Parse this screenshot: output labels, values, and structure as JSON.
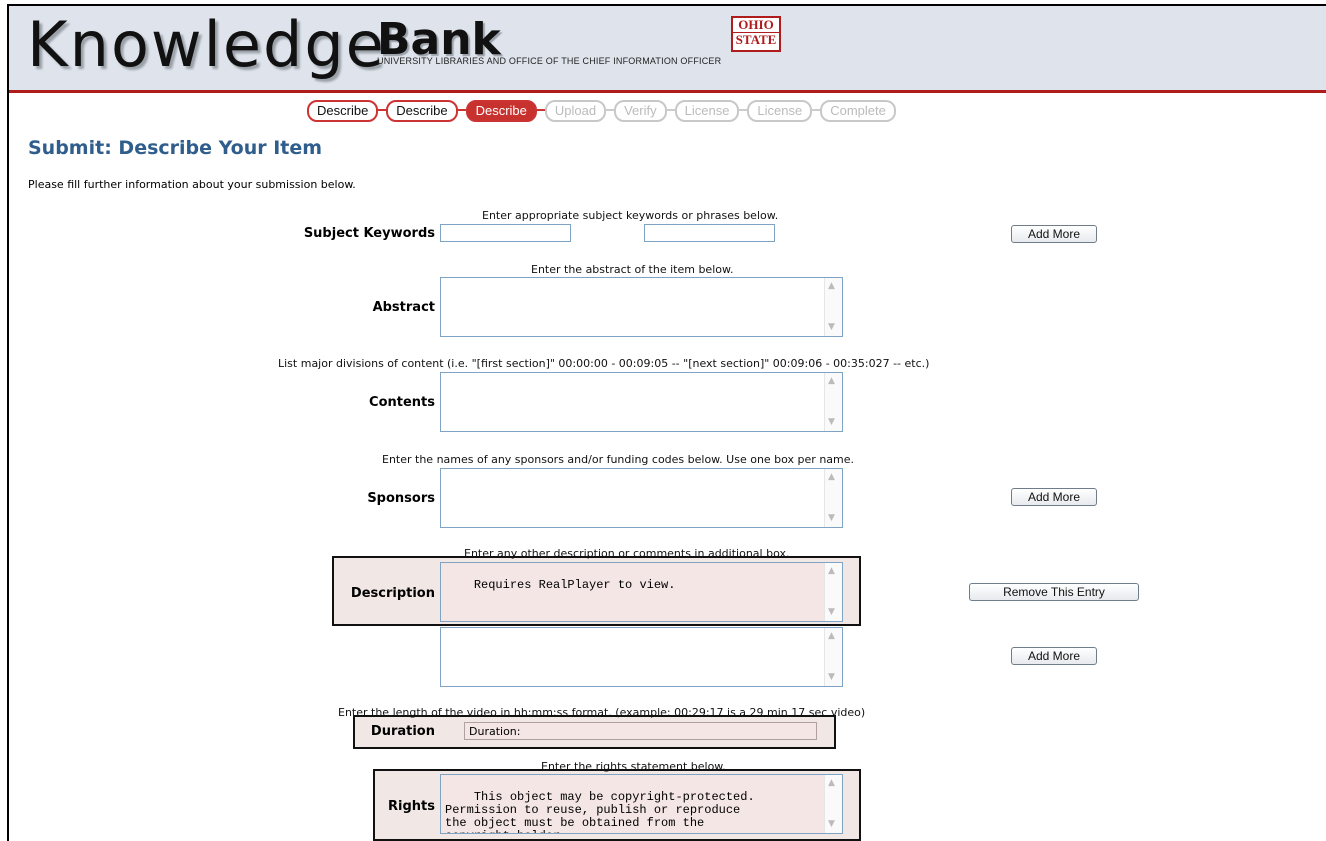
{
  "header": {
    "logo_word": "Knowledge",
    "logo_bank": "Bank",
    "subtitle": "UNIVERSITY LIBRARIES AND OFFICE OF THE CHIEF INFORMATION OFFICER",
    "seal_line1": "OHIO",
    "seal_line2": "STATE"
  },
  "progress": {
    "steps": [
      {
        "label": "Describe",
        "state": "done"
      },
      {
        "label": "Describe",
        "state": "done"
      },
      {
        "label": "Describe",
        "state": "active"
      },
      {
        "label": "Upload",
        "state": "future"
      },
      {
        "label": "Verify",
        "state": "future"
      },
      {
        "label": "License",
        "state": "future"
      },
      {
        "label": "License",
        "state": "future"
      },
      {
        "label": "Complete",
        "state": "future"
      }
    ]
  },
  "page": {
    "title": "Submit: Describe Your Item",
    "intro": "Please fill further information about your submission below."
  },
  "fields": {
    "subject": {
      "hint": "Enter appropriate subject keywords or phrases below.",
      "label": "Subject Keywords",
      "value1": "",
      "value2": "",
      "button": "Add More"
    },
    "abstract": {
      "hint": "Enter the abstract of the item below.",
      "label": "Abstract",
      "value": ""
    },
    "contents": {
      "hint": "List major divisions of content (i.e. \"[first section]\" 00:00:00 - 00:09:05 -- \"[next section]\" 00:09:06 - 00:35:027 -- etc.)",
      "label": "Contents",
      "value": ""
    },
    "sponsors": {
      "hint": "Enter the names of any sponsors and/or funding codes below. Use one box per name.",
      "label": "Sponsors",
      "value": "",
      "button": "Add More"
    },
    "description": {
      "hint": "Enter any other description or comments in additional box.",
      "label": "Description",
      "value": "Requires RealPlayer to view.",
      "remove_button": "Remove This Entry",
      "value2": "",
      "add_button": "Add More"
    },
    "duration": {
      "hint": "Enter the length of the video in hh:mm:ss format. (example: 00:29:17 is a 29 min 17 sec video)",
      "label": "Duration",
      "value": "Duration:"
    },
    "rights": {
      "hint": "Enter the rights statement below.",
      "label": "Rights",
      "value": "This object may be copyright-protected.\nPermission to reuse, publish or reproduce\nthe object must be obtained from the\ncopyright holder."
    }
  }
}
